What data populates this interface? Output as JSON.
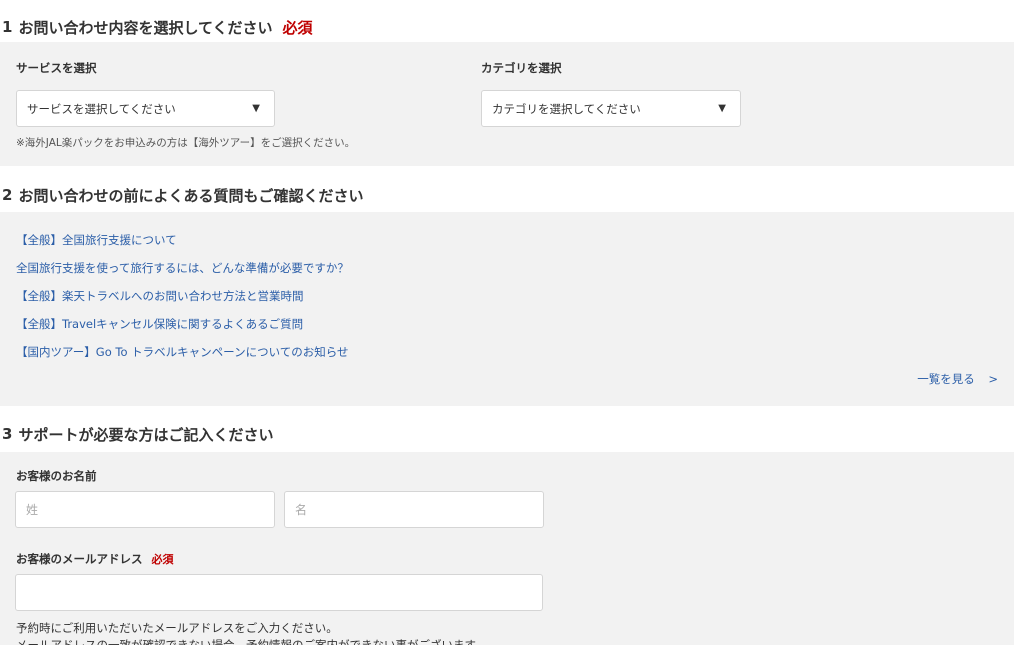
{
  "section1": {
    "number": "1",
    "title": "お問い合わせ内容を選択してください",
    "required": "必須",
    "service_label": "サービスを選択",
    "service_select": "サービスを選択してください",
    "category_label": "カテゴリを選択",
    "category_select": "カテゴリを選択してください",
    "note": "※海外JAL楽パックをお申込みの方は【海外ツアー】をご選択ください。",
    "arrow": "▼"
  },
  "section2": {
    "number": "2",
    "title": "お問い合わせの前によくある質問もご確認ください",
    "links": [
      "【全般】全国旅行支援について",
      "全国旅行支援を使って旅行するには、どんな準備が必要ですか？",
      "【全般】楽天トラベルへのお問い合わせ方法と営業時間",
      "【全般】Travelキャンセル保険に関するよくあるご質問",
      "【国内ツアー】Go To トラベルキャンペーンについてのお知らせ"
    ],
    "more_label": "一覧を見る",
    "more_chevron": ">"
  },
  "section3": {
    "number": "3",
    "title": "サポートが必要な方はご記入ください",
    "name_label": "お客様のお名前",
    "last_name_placeholder": "姓",
    "first_name_placeholder": "名",
    "email_label": "お客様のメールアドレス",
    "email_required": "必須",
    "email_value": "",
    "help_line1": "予約時にご利用いただいたメールアドレスをご入力ください。",
    "help_line2": "メールアドレスの一致が確認できない場合、予約情報のご案内ができない事がございます。"
  },
  "colors": {
    "required": "#bf0000",
    "link": "#2b5ea8",
    "panel_bg": "#f2f2f2"
  }
}
